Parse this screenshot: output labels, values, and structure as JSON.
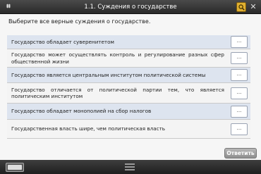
{
  "header": {
    "title": "1.1. Суждения о государстве",
    "logo_icon": "grid-logo-icon",
    "search_icon": "search-icon",
    "close_icon": "close-icon"
  },
  "prompt": "Выберите все верные суждения о государстве.",
  "rows": [
    {
      "text": "Государство обладает суверенитетом",
      "slot": "..."
    },
    {
      "text": "Государство может осуществлять контроль и регулирование разных сфер общественной жизни",
      "slot": "..."
    },
    {
      "text": "Государство является центральным институтом политической системы",
      "slot": "..."
    },
    {
      "text": "Государство отличается от политической партии тем, что является политическим институтом",
      "slot": "..."
    },
    {
      "text": "Государство обладает монополией на сбор налогов",
      "slot": "..."
    },
    {
      "text": "Государственная власть шире, чем политическая власть",
      "slot": "..."
    }
  ],
  "answer_label": "Ответить",
  "footer": {
    "logo_icon": "publisher-logo-icon",
    "menu_icon": "menu-icon"
  },
  "colors": {
    "shaded_row": "#dde4ef",
    "plain_row": "#f4f4f4",
    "topbar": "#333333"
  }
}
